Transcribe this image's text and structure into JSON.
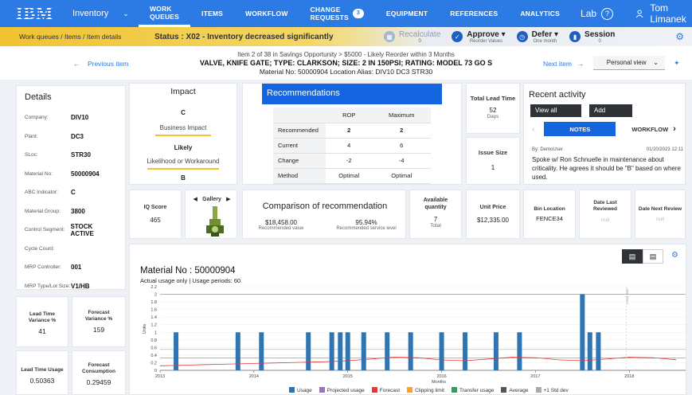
{
  "nav": {
    "logo": "IBM",
    "app": "Inventory",
    "items": [
      "WORK QUEUES",
      "ITEMS",
      "WORKFLOW",
      "CHANGE REQUESTS",
      "EQUIPMENT",
      "REFERENCES",
      "ANALYTICS"
    ],
    "change_requests_count": "3",
    "lab": "Lab",
    "user": "Tom Limanek"
  },
  "statusbar": {
    "breadcrumb": [
      "Work queues",
      "Items",
      "Item details"
    ],
    "status": "Status : X02 - Inventory decreased significantly",
    "actions": [
      {
        "label": "Recalculate",
        "sub": "0",
        "icon": "calculator-icon"
      },
      {
        "label": "Approve",
        "sub": "Reorder Values",
        "icon": "check-circle-icon"
      },
      {
        "label": "Defer",
        "sub": "One month",
        "icon": "clock-icon"
      },
      {
        "label": "Session",
        "sub": "0",
        "icon": "document-icon"
      }
    ]
  },
  "item": {
    "line1": "Item 2 of 38 in Savings Opportunity > $5000 - Likely Reorder within 3 Months",
    "line2": "VALVE, KNIFE GATE; TYPE: CLARKSON; SIZE: 2 IN 150PSI; RATING: MODEL 73 GO S",
    "line3": "Material No: 50000904  Location Alias: DIV10 DC3 STR30",
    "prev": "Previous item",
    "next": "Next item",
    "view": "Personal view"
  },
  "details": {
    "title": "Details",
    "rows": [
      {
        "k": "Company:",
        "v": "DIV10"
      },
      {
        "k": "Plant:",
        "v": "DC3"
      },
      {
        "k": "SLoc:",
        "v": "STR30"
      },
      {
        "k": "Material No:",
        "v": "50000904"
      },
      {
        "k": "ABC Indicator:",
        "v": "C"
      },
      {
        "k": "Material Group:",
        "v": "3800"
      },
      {
        "k": "Control Segment:",
        "v": "STOCK ACTIVE"
      },
      {
        "k": "Cycle Count:",
        "v": ""
      },
      {
        "k": "MRP Controller:",
        "v": "001"
      },
      {
        "k": "MRP Type/Lot Size:",
        "v": "V1/HB"
      }
    ]
  },
  "impact": {
    "title": "Impact",
    "business_grade": "C",
    "business_label": "Business Impact",
    "likelihood": "Likely",
    "likelihood_label": "Likelihood or Workaround",
    "overall": "B"
  },
  "recs": {
    "title": "Recommendations",
    "cols": [
      "ROP",
      "Maximum"
    ],
    "rows": [
      {
        "k": "Recommended",
        "a": "2",
        "b": "2",
        "bold": true
      },
      {
        "k": "Current",
        "a": "4",
        "b": "6"
      },
      {
        "k": "Change",
        "a": "-2",
        "b": "-4"
      },
      {
        "k": "Method",
        "a": "Optimal",
        "b": "Optimal"
      }
    ]
  },
  "tlt": {
    "label": "Total Lead Time",
    "value": "52",
    "unit": "Days"
  },
  "issue": {
    "label": "Issue Size",
    "value": "1"
  },
  "activity": {
    "title": "Recent activity",
    "view_all": "View all",
    "add": "Add",
    "tabs": [
      "NOTES",
      "WORKFLOW"
    ],
    "author": "By: DemoUser",
    "date": "01/20/2023 12:11",
    "note": "Spoke w/ Ron Schnuelle in maintenance about criticality. He agrees it should be \"B\" based on where used."
  },
  "iq": {
    "label": "IQ Score",
    "value": "465"
  },
  "gallery": {
    "label": "Gallery"
  },
  "compare": {
    "title": "Comparison of recommendation",
    "value": "$18,458.00",
    "value_label": "Recommended value",
    "service": "95.94%",
    "service_label": "Recommended service level"
  },
  "avail": {
    "label": "Available quantity",
    "value": "7",
    "sub": "Total"
  },
  "uprice": {
    "label": "Unit Price",
    "value": "$12,335.00"
  },
  "bin": {
    "label": "Bin Location",
    "value": "FENCE34"
  },
  "dlr": {
    "label": "Date Last Reviewed",
    "value": "null"
  },
  "dnr": {
    "label": "Date Next Review",
    "value": "null"
  },
  "kpis": [
    {
      "label": "Lead Time Variance %",
      "value": "41"
    },
    {
      "label": "Forecast Variance %",
      "value": "159"
    },
    {
      "label": "Lead Time Usage",
      "value": "0.50363"
    },
    {
      "label": "Forecast Consumption",
      "value": "0.29459"
    }
  ],
  "chart": {
    "title": "Material No : 50000904",
    "subtitle": "Actual usage only | Usage periods: 60",
    "legend": [
      {
        "name": "Usage",
        "color": "#2e75b6"
      },
      {
        "name": "Projected usage",
        "color": "#9b6fc3"
      },
      {
        "name": "Forecast",
        "color": "#e03a3a"
      },
      {
        "name": "Clipping limit",
        "color": "#f2a33a"
      },
      {
        "name": "Transfer usage",
        "color": "#2e9e5b"
      },
      {
        "name": "Average",
        "color": "#555555"
      },
      {
        "name": "+1 Std dev",
        "color": "#aaaaaa"
      }
    ]
  },
  "chart_data": {
    "type": "bar",
    "title": "Material No : 50000904",
    "xlabel": "Months",
    "ylabel": "Units",
    "x_ticks": [
      "2013",
      "2014",
      "2015",
      "2016",
      "2017",
      "2018"
    ],
    "y_ticks": [
      "0",
      "0.2",
      "0.4",
      "0.6",
      "0.8",
      "1",
      "1.2",
      "1.4",
      "1.6",
      "1.8",
      "2",
      "2.2"
    ],
    "ylim": [
      0,
      2.2
    ],
    "bar_months": [
      2013.17,
      2013.83,
      2014.08,
      2014.58,
      2014.83,
      2014.92,
      2015.0,
      2015.17,
      2015.42,
      2015.67,
      2016.0,
      2016.25,
      2016.58,
      2016.83,
      2017.5,
      2017.58,
      2017.67
    ],
    "bar_values": [
      1,
      1,
      1,
      1,
      1,
      1,
      1,
      1,
      1,
      1,
      1,
      1,
      1,
      1,
      2,
      1,
      1
    ],
    "clipping_limit": 2,
    "forecast_end": 0.3,
    "average": 0.32,
    "std_dev": 0.55,
    "xlim": [
      2013.0,
      2018.6
    ],
    "marker_label": "Lead time"
  }
}
